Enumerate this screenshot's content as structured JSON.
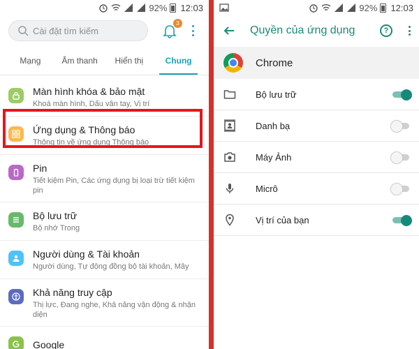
{
  "status_bar": {
    "battery": "92%",
    "time": "12:03"
  },
  "left": {
    "search": {
      "placeholder": "Cài đặt tìm kiếm"
    },
    "notification_count": "3",
    "tabs": [
      {
        "label": "Mạng"
      },
      {
        "label": "Âm thanh"
      },
      {
        "label": "Hiển thị"
      },
      {
        "label": "Chung"
      }
    ],
    "active_tab": "Chung",
    "items": [
      {
        "title": "Màn hình khóa & bảo mật",
        "sub": "Khoá màn hình, Dấu vân tay, Vị trí",
        "icon": "lock-icon",
        "color": "#9ccc65"
      },
      {
        "title": "Ứng dụng & Thông báo",
        "sub": "Thông tin về ứng dụng Thông báo",
        "icon": "apps-grid-icon",
        "color": "#ffb74d"
      },
      {
        "title": "Pin",
        "sub": "Tiết kiệm Pin, Các ứng dụng bị loại trừ tiết kiệm pin",
        "icon": "battery-icon",
        "color": "#ba68c8"
      },
      {
        "title": "Bộ lưu trữ",
        "sub": "Bộ nhớ Trong",
        "icon": "storage-icon",
        "color": "#66bb6a"
      },
      {
        "title": "Người dùng & Tài khoản",
        "sub": "Người dùng, Tự động đồng bộ tài khoản, Mây",
        "icon": "user-icon",
        "color": "#4fc3f7"
      },
      {
        "title": "Khả năng truy cập",
        "sub": "Thị lực, Đang nghe, Khả năng vận động & nhận diện",
        "icon": "accessibility-icon",
        "color": "#5c6bc0"
      },
      {
        "title": "Google",
        "sub": "",
        "icon": "google-icon",
        "color": "#8bc34a"
      }
    ]
  },
  "right": {
    "title": "Quyền của ứng dụng",
    "app_name": "Chrome",
    "accent": "#158a78",
    "permissions": [
      {
        "label": "Bộ lưu trữ",
        "icon": "folder-icon",
        "enabled": true
      },
      {
        "label": "Danh bạ",
        "icon": "contacts-icon",
        "enabled": false
      },
      {
        "label": "Máy Ảnh",
        "icon": "camera-icon",
        "enabled": false
      },
      {
        "label": "Micrô",
        "icon": "microphone-icon",
        "enabled": false
      },
      {
        "label": "Vị trí của bạn",
        "icon": "location-pin-icon",
        "enabled": true
      }
    ]
  }
}
